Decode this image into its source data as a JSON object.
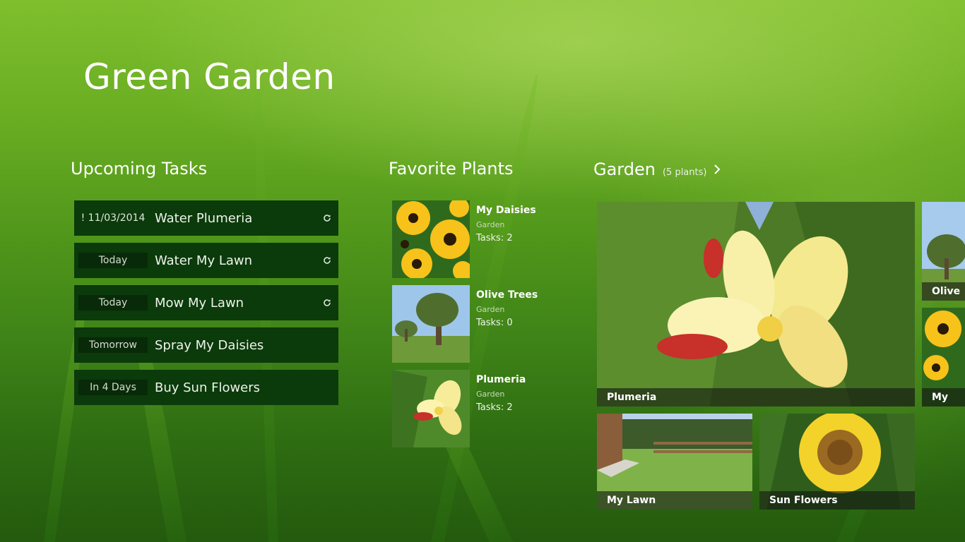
{
  "app": {
    "title": "Green Garden"
  },
  "tasks_section": {
    "title": "Upcoming Tasks",
    "items": [
      {
        "date": "! 11/03/2014",
        "name": "Water Plumeria",
        "repeat": true,
        "overdue": true
      },
      {
        "date": "Today",
        "name": "Water My Lawn",
        "repeat": true,
        "overdue": false
      },
      {
        "date": "Today",
        "name": "Mow My Lawn",
        "repeat": true,
        "overdue": false
      },
      {
        "date": "Tomorrow",
        "name": "Spray My Daisies",
        "repeat": false,
        "overdue": false
      },
      {
        "date": "In 4 Days",
        "name": "Buy Sun Flowers",
        "repeat": false,
        "overdue": false
      }
    ]
  },
  "favorites_section": {
    "title": "Favorite Plants",
    "items": [
      {
        "name": "My Daisies",
        "location": "Garden",
        "tasks": "Tasks: 2",
        "image": "daisies-photo"
      },
      {
        "name": "Olive Trees",
        "location": "Garden",
        "tasks": "Tasks: 0",
        "image": "olive-trees-photo"
      },
      {
        "name": "Plumeria",
        "location": "Garden",
        "tasks": "Tasks: 2",
        "image": "plumeria-photo"
      }
    ]
  },
  "garden_section": {
    "title": "Garden",
    "count": "(5 plants)",
    "tiles": [
      {
        "name": "Plumeria",
        "image": "plumeria-photo"
      },
      {
        "name": "My Lawn",
        "image": "lawn-photo"
      },
      {
        "name": "Sun Flowers",
        "image": "sunflower-photo"
      },
      {
        "name": "Olive Tr",
        "image": "olive-trees-photo"
      },
      {
        "name": "My Dai",
        "image": "daisies-photo"
      }
    ]
  },
  "colors": {
    "task_tile": "#0b3a0b",
    "task_date": "#082a08",
    "caption_overlay": "#141912"
  }
}
